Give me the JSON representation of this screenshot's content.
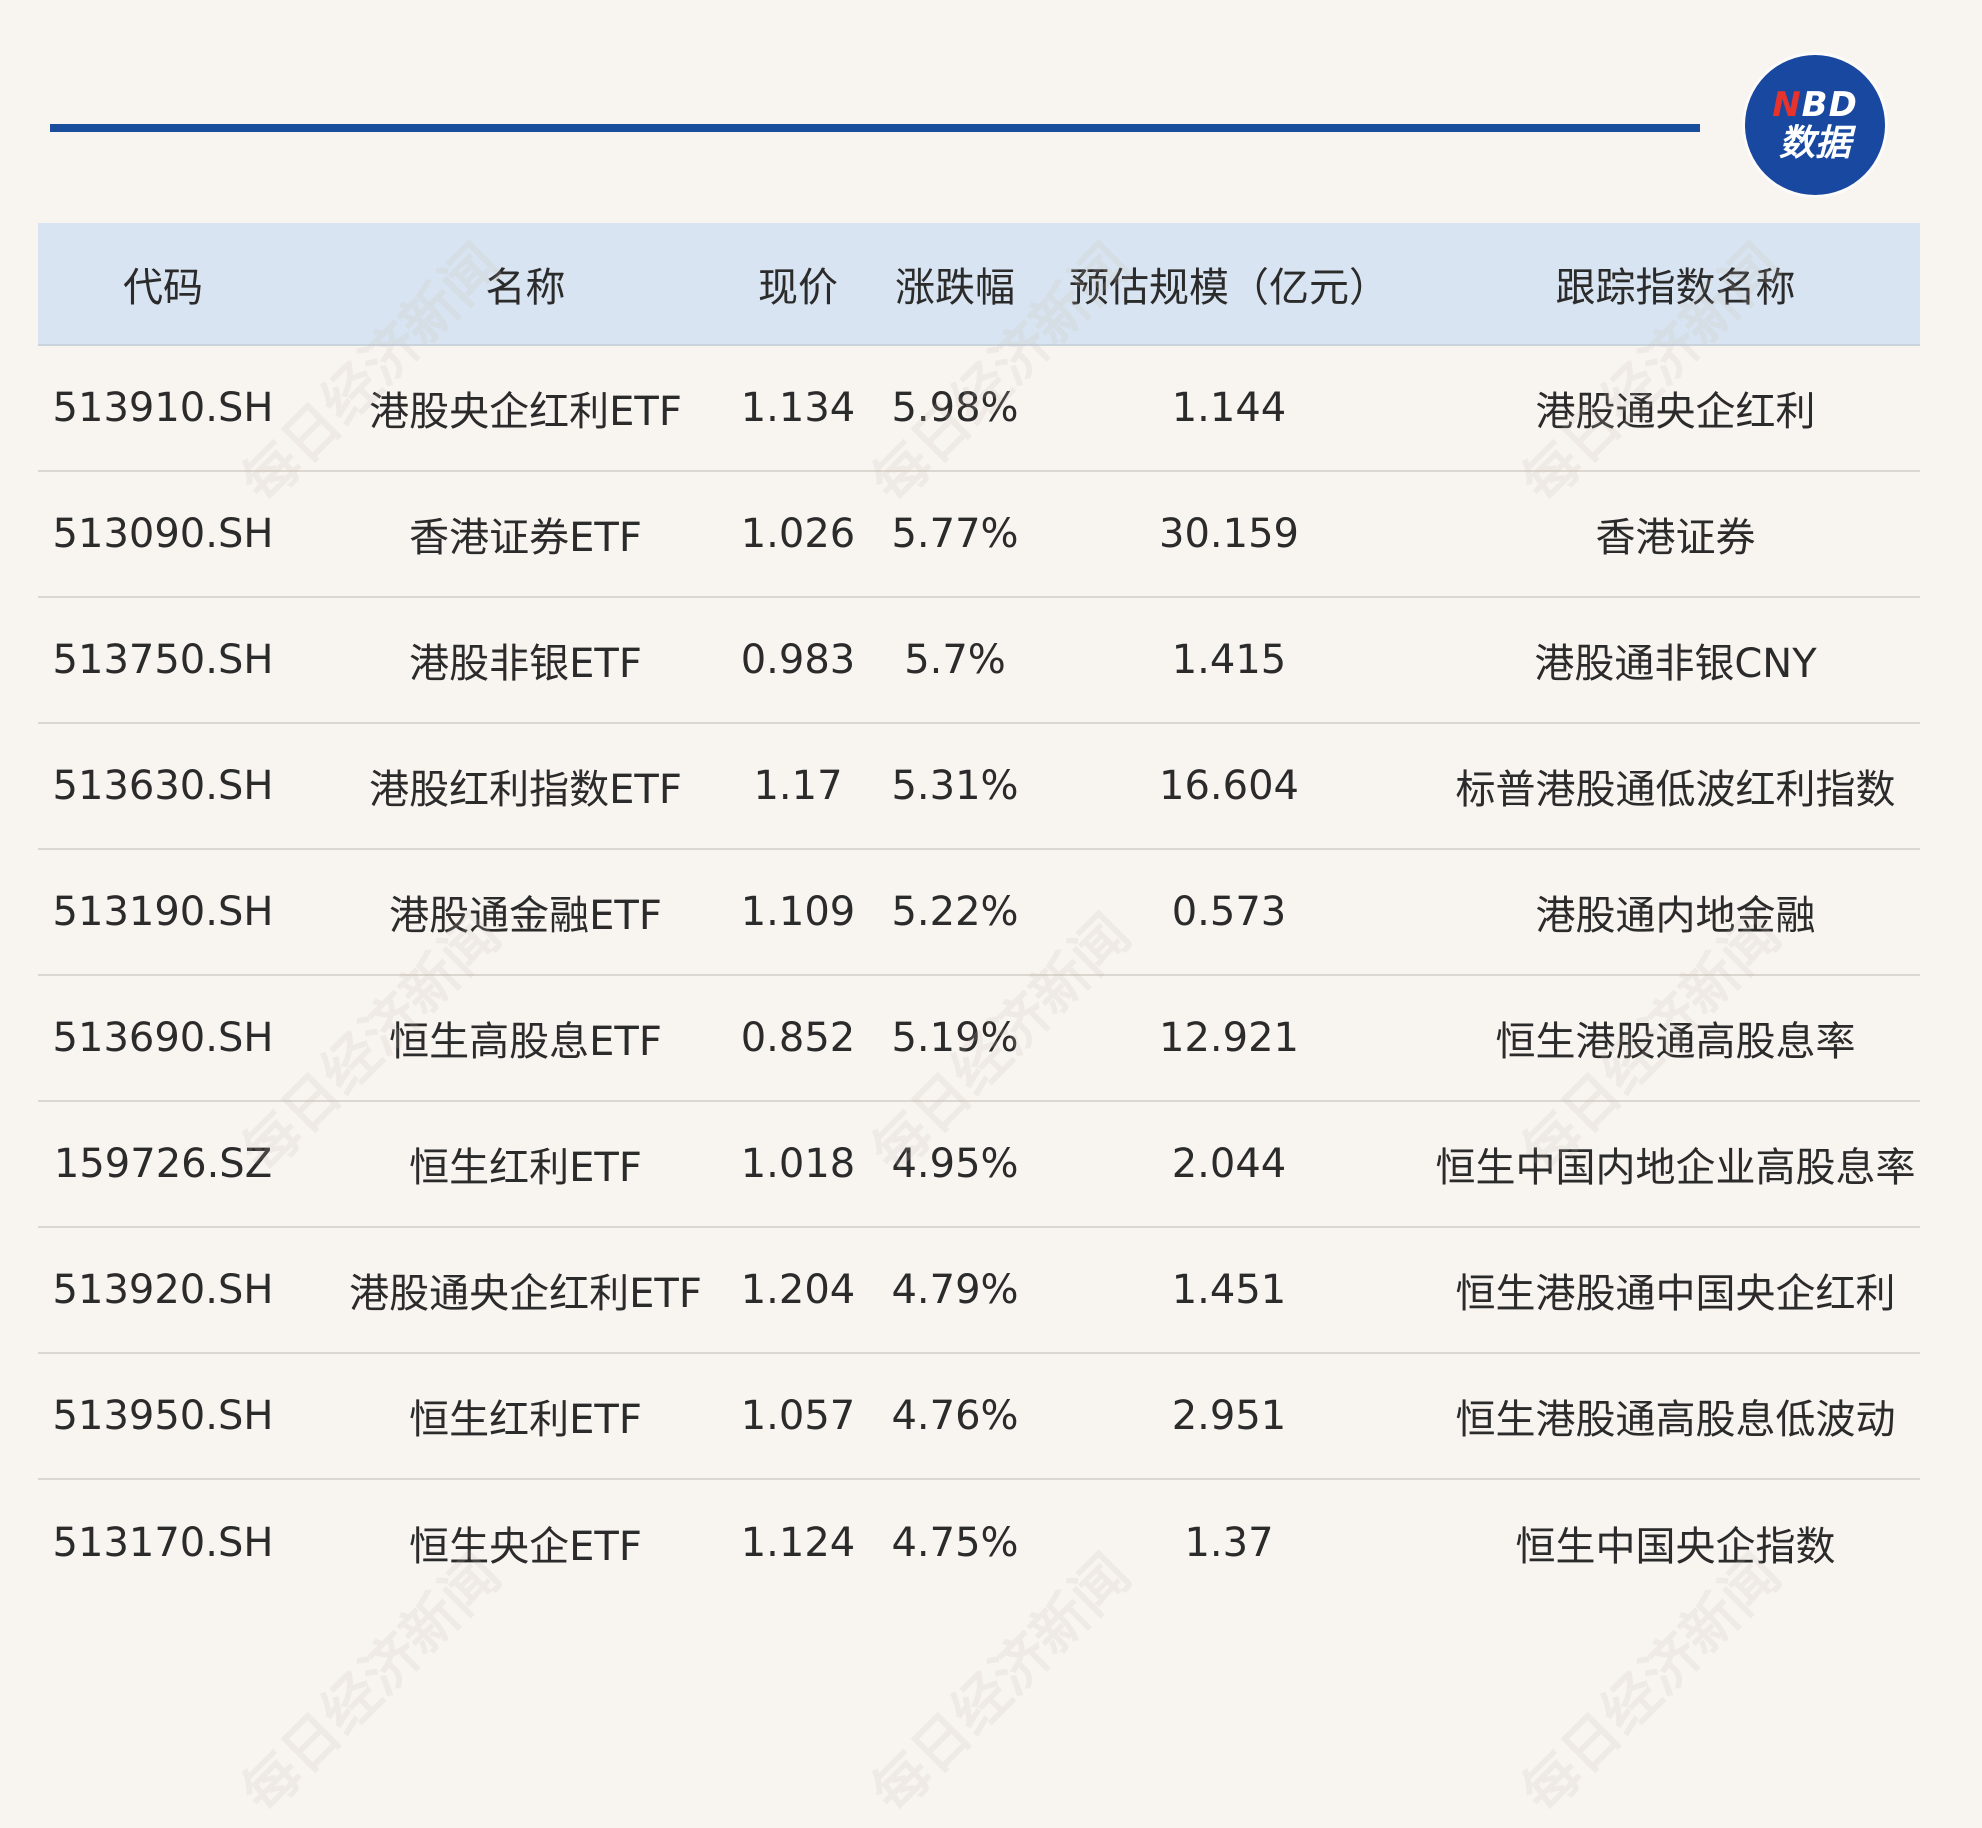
{
  "logo": {
    "top": "NBD",
    "bottom": "数据"
  },
  "watermark_text": "每日经济新闻",
  "chart_data": {
    "type": "table",
    "columns": [
      "代码",
      "名称",
      "现价",
      "涨跌幅",
      "预估规模（亿元）",
      "跟踪指数名称"
    ],
    "rows": [
      [
        "513910.SH",
        "港股央企红利ETF",
        "1.134",
        "5.98%",
        "1.144",
        "港股通央企红利"
      ],
      [
        "513090.SH",
        "香港证券ETF",
        "1.026",
        "5.77%",
        "30.159",
        "香港证券"
      ],
      [
        "513750.SH",
        "港股非银ETF",
        "0.983",
        "5.7%",
        "1.415",
        "港股通非银CNY"
      ],
      [
        "513630.SH",
        "港股红利指数ETF",
        "1.17",
        "5.31%",
        "16.604",
        "标普港股通低波红利指数"
      ],
      [
        "513190.SH",
        "港股通金融ETF",
        "1.109",
        "5.22%",
        "0.573",
        "港股通内地金融"
      ],
      [
        "513690.SH",
        "恒生高股息ETF",
        "0.852",
        "5.19%",
        "12.921",
        "恒生港股通高股息率"
      ],
      [
        "159726.SZ",
        "恒生红利ETF",
        "1.018",
        "4.95%",
        "2.044",
        "恒生中国内地企业高股息率"
      ],
      [
        "513920.SH",
        "港股通央企红利ETF",
        "1.204",
        "4.79%",
        "1.451",
        "恒生港股通中国央企红利"
      ],
      [
        "513950.SH",
        "恒生红利ETF",
        "1.057",
        "4.76%",
        "2.951",
        "恒生港股通高股息低波动"
      ],
      [
        "513170.SH",
        "恒生央企ETF",
        "1.124",
        "4.75%",
        "1.37",
        "恒生中国央企指数"
      ]
    ]
  }
}
